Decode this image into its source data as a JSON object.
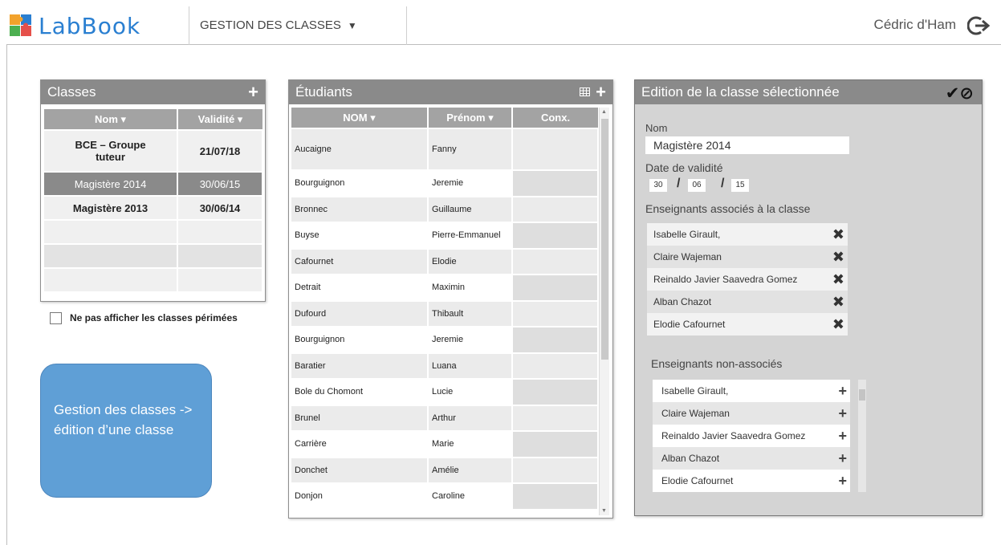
{
  "app": {
    "logo_text": "LabBook",
    "menu_label": "GESTION DES CLASSES",
    "user_name": "Cédric d'Ham"
  },
  "classes_panel": {
    "title": "Classes",
    "columns": [
      "Nom ▾",
      "Validité ▾"
    ],
    "rows": [
      {
        "name": "BCE – Groupe tuteur",
        "validity": "21/07/18"
      },
      {
        "name": "Magistère 2014",
        "validity": "30/06/15"
      },
      {
        "name": "Magistère 2013",
        "validity": "30/06/14"
      }
    ],
    "hide_expired_label": "Ne pas afficher les classes périmées"
  },
  "note": {
    "text": "Gestion des classes -> édition d’une classe"
  },
  "students_panel": {
    "title": "Étudiants",
    "columns": [
      "NOM ▾",
      "Prénom ▾",
      "Conx."
    ],
    "rows": [
      {
        "nom": "Aucaigne",
        "prenom": "Fanny"
      },
      {
        "nom": "Bourguignon",
        "prenom": "Jeremie"
      },
      {
        "nom": "Bronnec",
        "prenom": "Guillaume"
      },
      {
        "nom": "Buyse",
        "prenom": "Pierre-Emmanuel"
      },
      {
        "nom": "Cafournet",
        "prenom": "Elodie"
      },
      {
        "nom": "Detrait",
        "prenom": "Maximin"
      },
      {
        "nom": "Dufourd",
        "prenom": "Thibault"
      },
      {
        "nom": "Bourguignon",
        "prenom": "Jeremie"
      },
      {
        "nom": "Baratier",
        "prenom": "Luana"
      },
      {
        "nom": "Bole du Chomont",
        "prenom": "Lucie"
      },
      {
        "nom": "Brunel",
        "prenom": "Arthur"
      },
      {
        "nom": "Carrière",
        "prenom": "Marie"
      },
      {
        "nom": "Donchet",
        "prenom": "Amélie"
      },
      {
        "nom": "Donjon",
        "prenom": "Caroline"
      }
    ]
  },
  "edition_panel": {
    "title": "Edition de la classe sélectionnée",
    "nom_label": "Nom",
    "nom_value": "Magistère 2014",
    "date_label": "Date de validité",
    "date": {
      "day": "30",
      "month": "06",
      "year": "15"
    },
    "date_sep": "/",
    "associated_label": "Enseignants associés à la classe",
    "associated": [
      "Isabelle Girault,",
      "Claire Wajeman",
      "Reinaldo Javier Saavedra Gomez",
      "Alban Chazot",
      "Elodie Cafournet"
    ],
    "non_associated_label": "Enseignants non-associés",
    "non_associated": [
      "Isabelle Girault,",
      "Claire Wajeman",
      "Reinaldo Javier Saavedra Gomez",
      "Alban Chazot",
      "Elodie Cafournet"
    ]
  },
  "icons": {
    "add": "+",
    "remove": "✖",
    "validate": "✔",
    "cancel": "⊘"
  },
  "colors": {
    "panel_header": "#8a8a8a",
    "note_blue": "#5f9fd6",
    "logo_blue": "#2a7fd1"
  }
}
